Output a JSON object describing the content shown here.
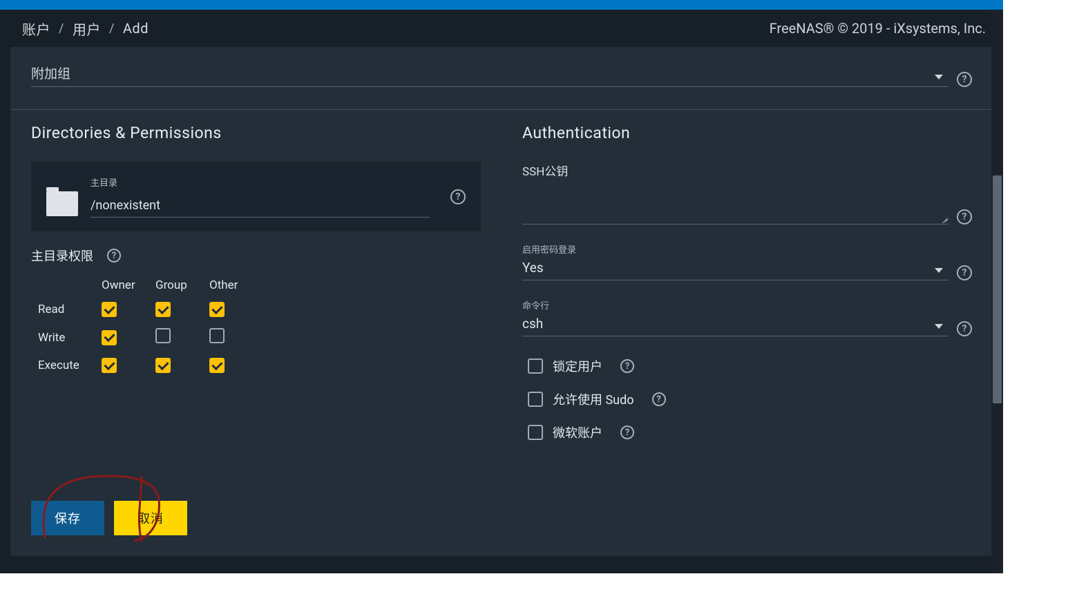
{
  "breadcrumb": {
    "item1": "账户",
    "item2": "用户",
    "item3": "Add"
  },
  "copyright": "FreeNAS® © 2019 - iXsystems, Inc.",
  "aux_groups": {
    "label": "附加组"
  },
  "sections": {
    "dirperm_title": "Directories & Permissions",
    "auth_title": "Authentication"
  },
  "home_dir": {
    "label": "主目录",
    "value": "/nonexistent"
  },
  "perm_label": "主目录权限",
  "perm_headers": {
    "owner": "Owner",
    "group": "Group",
    "other": "Other"
  },
  "perm_rows": {
    "read": "Read",
    "write": "Write",
    "execute": "Execute"
  },
  "auth": {
    "ssh_label": "SSH公钥",
    "pw_login_label": "启用密码登录",
    "pw_login_value": "Yes",
    "shell_label": "命令行",
    "shell_value": "csh",
    "lock_user": "锁定用户",
    "allow_sudo": "允许使用 Sudo",
    "ms_account": "微软账户"
  },
  "buttons": {
    "save": "保存",
    "cancel": "取消"
  }
}
